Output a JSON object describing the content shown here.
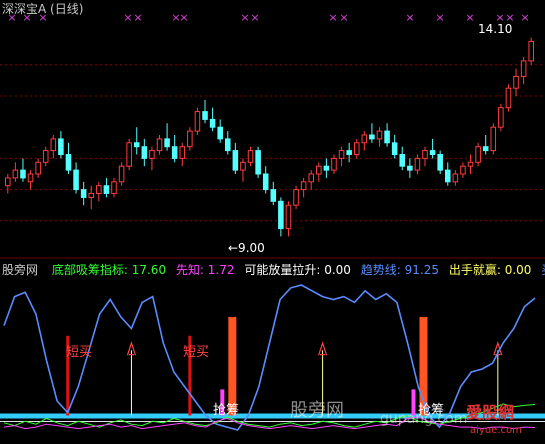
{
  "window": {
    "title_stock": "深深宝A",
    "title_period": "(日线)",
    "title_color": "#c8c8c8"
  },
  "price_panel": {
    "high_label": "14.10",
    "low_label": "←9.00",
    "marker_glyph": "×",
    "marker_color": "#e040e0",
    "up_color": "#ff3c3c",
    "down_color": "#54ffff"
  },
  "indicator_header": {
    "site": "股旁网",
    "items": [
      {
        "label": "底部吸筹指标:",
        "value": "17.60",
        "color": "#33ff33"
      },
      {
        "label": "先知:",
        "value": "1.72",
        "color": "#ff44ff"
      },
      {
        "label": "可能放量拉升:",
        "value": "0.00",
        "color": "#ffffff"
      },
      {
        "label": "趋势线:",
        "value": "91.25",
        "color": "#5a8cff"
      },
      {
        "label": "出手就赢:",
        "value": "0.00",
        "color": "#ffff66"
      },
      {
        "label": "买点",
        "value": "",
        "color": "#5a8cff"
      }
    ]
  },
  "annotations": {
    "buy_short_1": "短买",
    "buy_short_2": "短买",
    "signal_1": "抢筹",
    "signal_2": "抢筹"
  },
  "watermarks": {
    "cn": "股旁网",
    "en": "gupang.com",
    "logo": "愛股網",
    "logo_en": "aiyue.com"
  },
  "chart_data": [
    {
      "type": "candlestick",
      "title": "深深宝A (日线)",
      "ylim": [
        8.6,
        14.6
      ],
      "annotations": [
        {
          "text": "14.10",
          "kind": "high"
        },
        {
          "text": "9.00",
          "kind": "low"
        }
      ],
      "ohlc": [
        [
          10.3,
          10.6,
          10.1,
          10.5
        ],
        [
          10.5,
          10.9,
          10.4,
          10.7
        ],
        [
          10.7,
          11.0,
          10.4,
          10.5
        ],
        [
          10.4,
          10.7,
          10.2,
          10.6
        ],
        [
          10.6,
          11.0,
          10.5,
          10.9
        ],
        [
          10.9,
          11.3,
          10.8,
          11.2
        ],
        [
          11.2,
          11.6,
          11.0,
          11.5
        ],
        [
          11.5,
          11.7,
          11.0,
          11.1
        ],
        [
          11.1,
          11.4,
          10.6,
          10.7
        ],
        [
          10.7,
          10.9,
          10.1,
          10.2
        ],
        [
          10.2,
          10.4,
          9.8,
          10.0
        ],
        [
          10.0,
          10.3,
          9.7,
          10.1
        ],
        [
          10.1,
          10.4,
          9.9,
          10.3
        ],
        [
          10.3,
          10.5,
          10.0,
          10.1
        ],
        [
          10.1,
          10.5,
          10.0,
          10.4
        ],
        [
          10.4,
          10.9,
          10.3,
          10.8
        ],
        [
          10.8,
          11.5,
          10.7,
          11.4
        ],
        [
          11.4,
          11.8,
          11.1,
          11.3
        ],
        [
          11.3,
          11.5,
          10.8,
          11.0
        ],
        [
          11.0,
          11.3,
          10.7,
          11.2
        ],
        [
          11.2,
          11.6,
          11.1,
          11.5
        ],
        [
          11.5,
          11.9,
          11.2,
          11.3
        ],
        [
          11.3,
          11.6,
          10.9,
          11.0
        ],
        [
          11.0,
          11.4,
          10.8,
          11.3
        ],
        [
          11.3,
          11.8,
          11.2,
          11.7
        ],
        [
          11.7,
          12.3,
          11.6,
          12.2
        ],
        [
          12.2,
          12.5,
          11.9,
          12.0
        ],
        [
          12.0,
          12.3,
          11.7,
          11.8
        ],
        [
          11.8,
          12.0,
          11.4,
          11.5
        ],
        [
          11.5,
          11.7,
          11.1,
          11.2
        ],
        [
          11.2,
          11.4,
          10.6,
          10.7
        ],
        [
          10.7,
          11.0,
          10.4,
          10.9
        ],
        [
          10.9,
          11.3,
          10.8,
          11.2
        ],
        [
          11.2,
          11.3,
          10.5,
          10.6
        ],
        [
          10.6,
          10.8,
          10.1,
          10.2
        ],
        [
          10.2,
          10.4,
          9.8,
          9.9
        ],
        [
          9.9,
          10.0,
          9.0,
          9.2
        ],
        [
          9.2,
          9.9,
          9.0,
          9.8
        ],
        [
          9.8,
          10.3,
          9.7,
          10.2
        ],
        [
          10.2,
          10.5,
          10.0,
          10.4
        ],
        [
          10.4,
          10.7,
          10.2,
          10.6
        ],
        [
          10.6,
          10.9,
          10.4,
          10.8
        ],
        [
          10.8,
          11.0,
          10.5,
          10.7
        ],
        [
          10.7,
          11.1,
          10.6,
          11.0
        ],
        [
          11.0,
          11.3,
          10.8,
          11.2
        ],
        [
          11.2,
          11.4,
          10.9,
          11.1
        ],
        [
          11.1,
          11.5,
          11.0,
          11.4
        ],
        [
          11.4,
          11.7,
          11.2,
          11.6
        ],
        [
          11.6,
          11.9,
          11.4,
          11.5
        ],
        [
          11.5,
          11.8,
          11.3,
          11.7
        ],
        [
          11.7,
          11.9,
          11.3,
          11.4
        ],
        [
          11.4,
          11.6,
          11.0,
          11.1
        ],
        [
          11.1,
          11.3,
          10.7,
          10.8
        ],
        [
          10.8,
          11.0,
          10.5,
          10.7
        ],
        [
          10.7,
          11.1,
          10.6,
          11.0
        ],
        [
          11.0,
          11.3,
          10.8,
          11.2
        ],
        [
          11.2,
          11.5,
          11.0,
          11.1
        ],
        [
          11.1,
          11.2,
          10.6,
          10.7
        ],
        [
          10.7,
          10.9,
          10.3,
          10.4
        ],
        [
          10.4,
          10.7,
          10.3,
          10.6
        ],
        [
          10.6,
          10.9,
          10.5,
          10.8
        ],
        [
          10.8,
          11.1,
          10.6,
          10.9
        ],
        [
          10.9,
          11.4,
          10.8,
          11.3
        ],
        [
          11.3,
          11.6,
          11.1,
          11.2
        ],
        [
          11.2,
          11.9,
          11.1,
          11.8
        ],
        [
          11.8,
          12.4,
          11.7,
          12.3
        ],
        [
          12.3,
          12.9,
          12.2,
          12.8
        ],
        [
          12.8,
          13.3,
          12.6,
          13.1
        ],
        [
          13.1,
          13.6,
          12.9,
          13.5
        ],
        [
          13.5,
          14.1,
          13.4,
          14.0
        ]
      ]
    },
    {
      "type": "line",
      "series": [
        {
          "name": "趋势线",
          "color": "#5a8cff",
          "values": [
            72,
            92,
            95,
            80,
            48,
            20,
            12,
            30,
            55,
            80,
            90,
            78,
            70,
            88,
            92,
            60,
            40,
            30,
            20,
            10,
            4,
            2,
            0,
            10,
            30,
            60,
            90,
            98,
            100,
            96,
            92,
            90,
            92,
            88,
            96,
            90,
            94,
            88,
            60,
            30,
            10,
            2,
            12,
            30,
            40,
            42,
            46,
            60,
            70,
            85,
            91
          ]
        },
        {
          "name": "底部吸筹指标",
          "color": "#33ff33",
          "values": [
            5,
            3,
            6,
            4,
            8,
            5,
            3,
            6,
            4,
            2,
            5,
            7,
            4,
            3,
            6,
            5,
            8,
            6,
            4,
            3,
            5,
            9,
            6,
            4,
            3,
            2,
            4,
            5,
            3,
            4,
            6,
            5,
            3,
            2,
            4,
            6,
            5,
            8,
            10,
            6,
            5,
            4,
            6,
            8,
            10,
            12,
            15,
            18,
            16,
            17,
            17.6
          ]
        },
        {
          "name": "先知",
          "color": "#ff44ff",
          "values": [
            2,
            3,
            1,
            2,
            4,
            3,
            2,
            1,
            2,
            3,
            4,
            2,
            3,
            1,
            2,
            3,
            4,
            5,
            3,
            2,
            6,
            8,
            5,
            3,
            2,
            1,
            2,
            3,
            2,
            1,
            2,
            3,
            2,
            1,
            2,
            3,
            4,
            3,
            8,
            9,
            6,
            4,
            3,
            2,
            2,
            1,
            2,
            2,
            1,
            2,
            1.72
          ]
        }
      ],
      "bars": [
        {
          "name": "短买",
          "positions": [
            0.12,
            0.35
          ],
          "color": "#dd1111"
        },
        {
          "name": "可能放量拉升",
          "positions": [
            0.43,
            0.79
          ],
          "color": "#ff5522"
        }
      ],
      "ylim": [
        0,
        100
      ],
      "threshold": 10
    }
  ]
}
